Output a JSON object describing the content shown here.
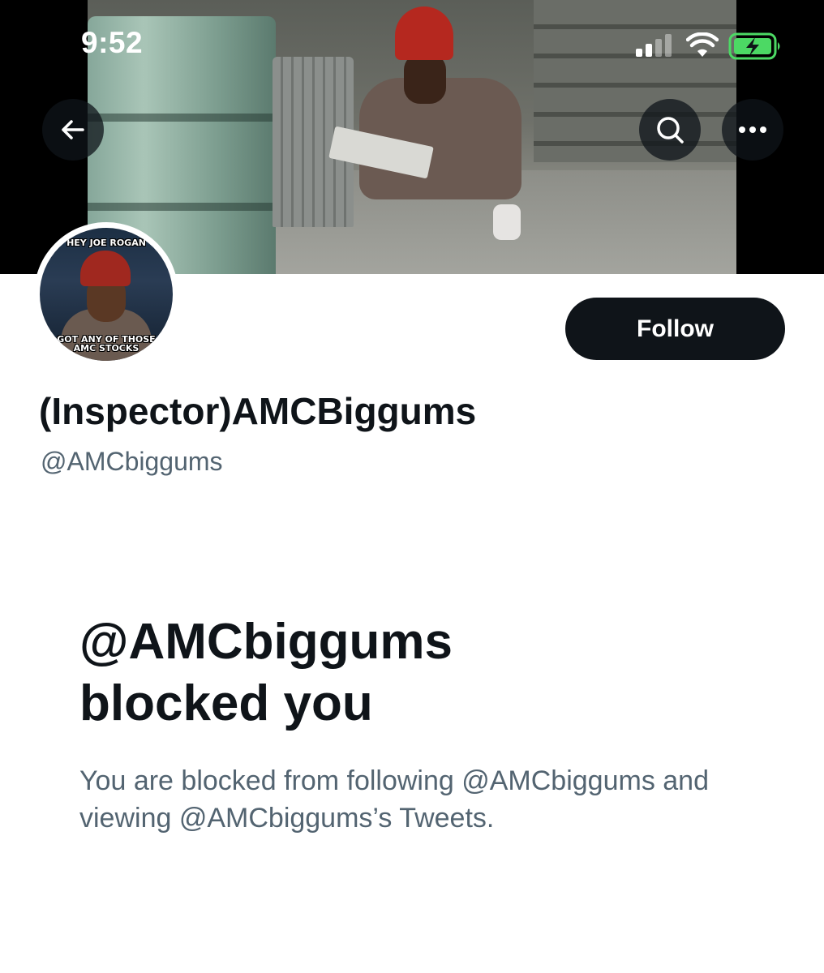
{
  "status_bar": {
    "time": "9:52",
    "signal_icon": "cellular-signal-icon",
    "wifi_icon": "wifi-icon",
    "battery_icon": "battery-charging-icon"
  },
  "header": {
    "back_icon": "arrow-left-icon",
    "search_icon": "search-icon",
    "more_icon": "more-options-icon"
  },
  "avatar": {
    "top_text": "HEY JOE ROGAN",
    "bottom_text_line1": "GOT ANY OF THOSE",
    "bottom_text_line2": "AMC STOCKS"
  },
  "profile": {
    "follow_label": "Follow",
    "display_name": "(Inspector)AMCBiggums",
    "handle": "@AMCbiggums"
  },
  "blocked": {
    "title_line1": "@AMCbiggums",
    "title_line2": "blocked you",
    "description": "You are blocked from following @AMCbiggums and viewing @AMCbiggums’s Tweets."
  },
  "colors": {
    "primary_text": "#0f1419",
    "secondary_text": "#536471",
    "battery_green": "#4cd964",
    "button_dark": "#0f1419"
  }
}
